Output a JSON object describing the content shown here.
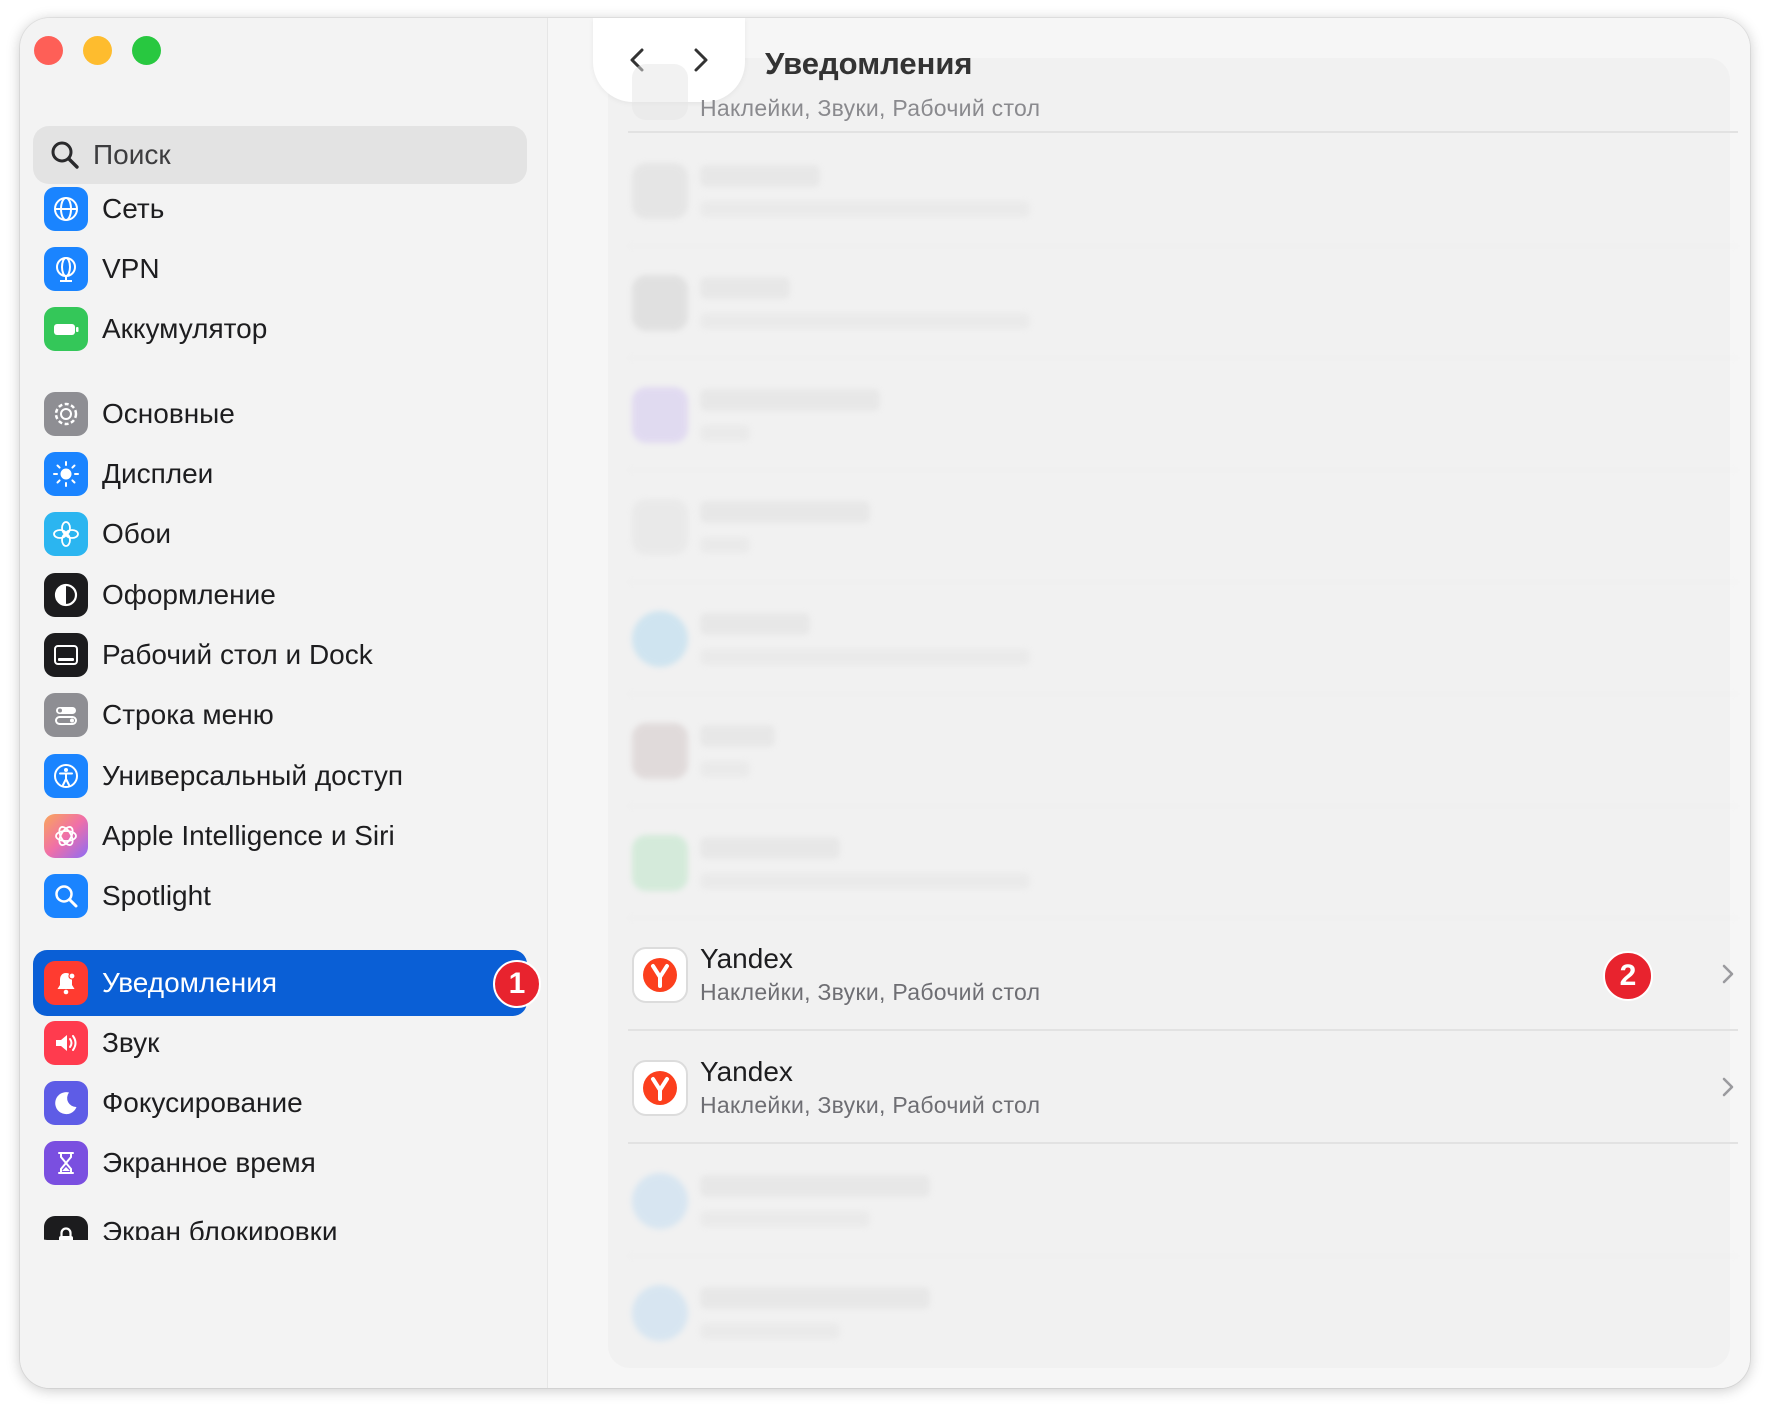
{
  "window": {
    "title": "Уведомления"
  },
  "search": {
    "placeholder": "Поиск"
  },
  "sidebar": {
    "items": [
      {
        "label": "Сеть",
        "icon": "globe-icon",
        "color": "#1a84ff"
      },
      {
        "label": "VPN",
        "icon": "vpn-globe-icon",
        "color": "#1a84ff"
      },
      {
        "label": "Аккумулятор",
        "icon": "battery-icon",
        "color": "#34c759"
      },
      {
        "label": "Основные",
        "icon": "gear-icon",
        "color": "#8e8e93"
      },
      {
        "label": "Дисплеи",
        "icon": "sun-icon",
        "color": "#1a84ff"
      },
      {
        "label": "Обои",
        "icon": "flower-icon",
        "color": "#2bb5f0"
      },
      {
        "label": "Оформление",
        "icon": "appearance-icon",
        "color": "#1c1c1e"
      },
      {
        "label": "Рабочий стол и Dock",
        "icon": "dock-icon",
        "color": "#1c1c1e"
      },
      {
        "label": "Строка меню",
        "icon": "menubar-icon",
        "color": "#8e8e93"
      },
      {
        "label": "Универсальный доступ",
        "icon": "accessibility-icon",
        "color": "#1a84ff"
      },
      {
        "label": "Apple Intelligence и Siri",
        "icon": "siri-icon",
        "color": "#f07ab0"
      },
      {
        "label": "Spotlight",
        "icon": "magnifier-icon",
        "color": "#1a84ff"
      },
      {
        "label": "Уведомления",
        "icon": "bell-icon",
        "color": "#ff3b30",
        "selected": true,
        "badge": "1"
      },
      {
        "label": "Звук",
        "icon": "speaker-icon",
        "color": "#ff3b4e"
      },
      {
        "label": "Фокусирование",
        "icon": "moon-icon",
        "color": "#5e5ce6"
      },
      {
        "label": "Экранное время",
        "icon": "hourglass-icon",
        "color": "#7a4fe0"
      },
      {
        "label": "Экран блокировки",
        "icon": "lock-icon",
        "color": "#1c1c1e"
      }
    ]
  },
  "main": {
    "top_row": {
      "subtitle": "Наклейки, Звуки, Рабочий стол"
    },
    "apps": [
      {
        "name": "Yandex",
        "subtitle": "Наклейки, Звуки, Рабочий стол",
        "badge": "2"
      },
      {
        "name": "Yandex",
        "subtitle": "Наклейки, Звуки, Рабочий стол"
      }
    ]
  },
  "colors": {
    "accent": "#0a5fd6",
    "badge": "#e8232e",
    "yandex_red": "#fc3f1d"
  }
}
